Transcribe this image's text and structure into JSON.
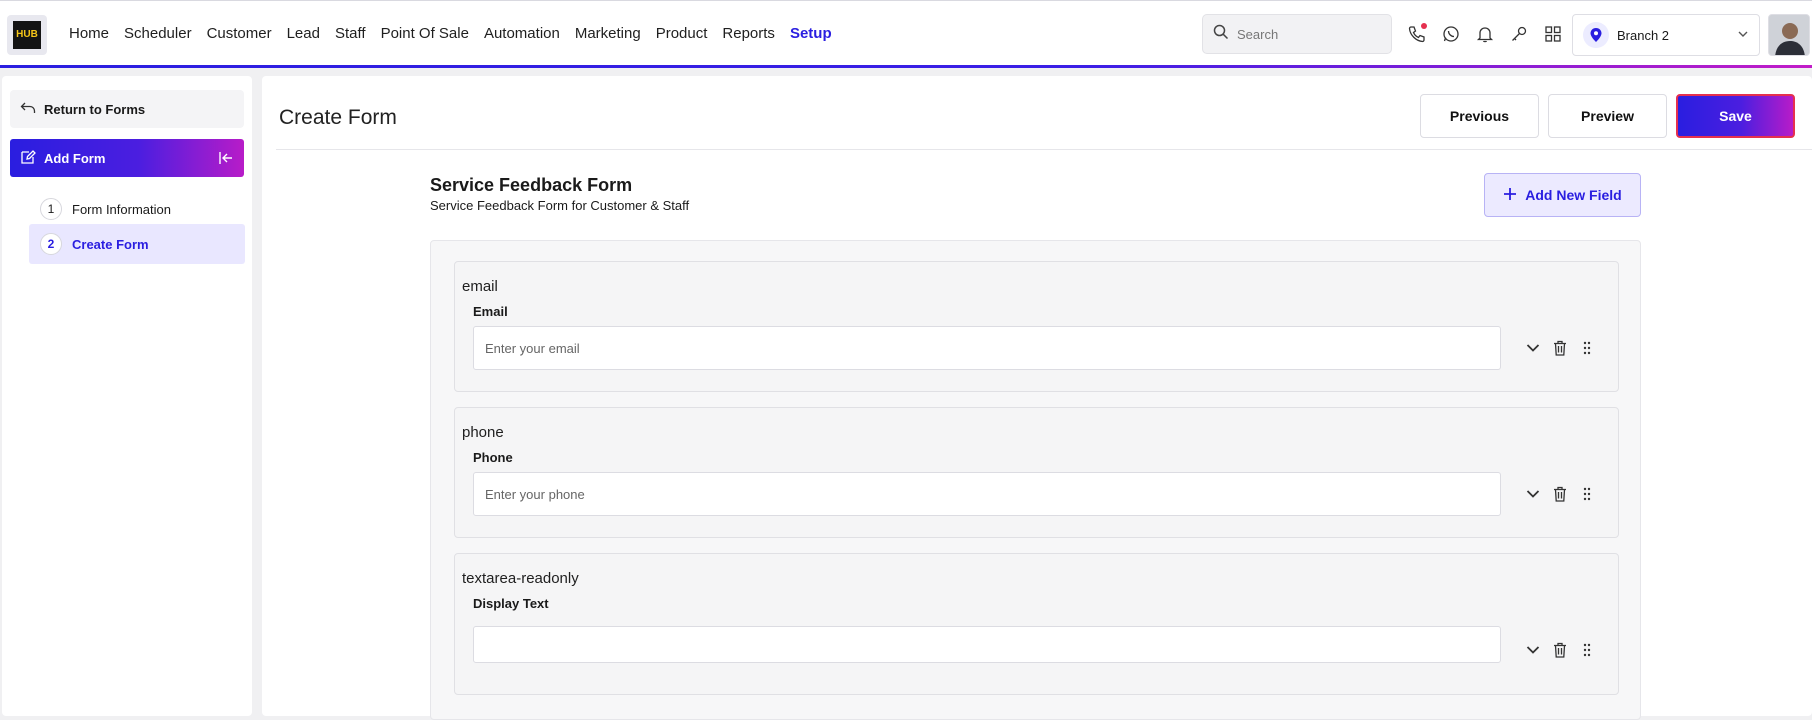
{
  "brand": {
    "logo_text": "HUB"
  },
  "nav": {
    "items": [
      "Home",
      "Scheduler",
      "Customer",
      "Lead",
      "Staff",
      "Point Of Sale",
      "Automation",
      "Marketing",
      "Product",
      "Reports",
      "Setup"
    ],
    "active": "Setup"
  },
  "search": {
    "placeholder": "Search"
  },
  "header_icons": [
    "phone-icon",
    "whatsapp-icon",
    "bell-icon",
    "key-icon",
    "apps-grid-icon"
  ],
  "branch": {
    "label": "Branch 2"
  },
  "sidebar": {
    "return_label": "Return to Forms",
    "section_label": "Add Form",
    "steps": [
      {
        "num": "1",
        "label": "Form Information"
      },
      {
        "num": "2",
        "label": "Create Form"
      }
    ]
  },
  "main": {
    "title": "Create Form",
    "buttons": {
      "previous": "Previous",
      "preview": "Preview",
      "save": "Save"
    },
    "form_title": "Service Feedback Form",
    "form_subtitle": "Service Feedback Form for Customer & Staff",
    "add_field_label": "Add New Field",
    "fields": [
      {
        "type": "email",
        "label": "Email",
        "placeholder": "Enter your email"
      },
      {
        "type": "phone",
        "label": "Phone",
        "placeholder": "Enter your phone"
      },
      {
        "type": "textarea-readonly",
        "label": "Display Text",
        "placeholder": ""
      }
    ]
  },
  "colors": {
    "accent": "#2a1ee0",
    "gradient_end": "#b81cc8",
    "save_border": "#e5304f"
  }
}
